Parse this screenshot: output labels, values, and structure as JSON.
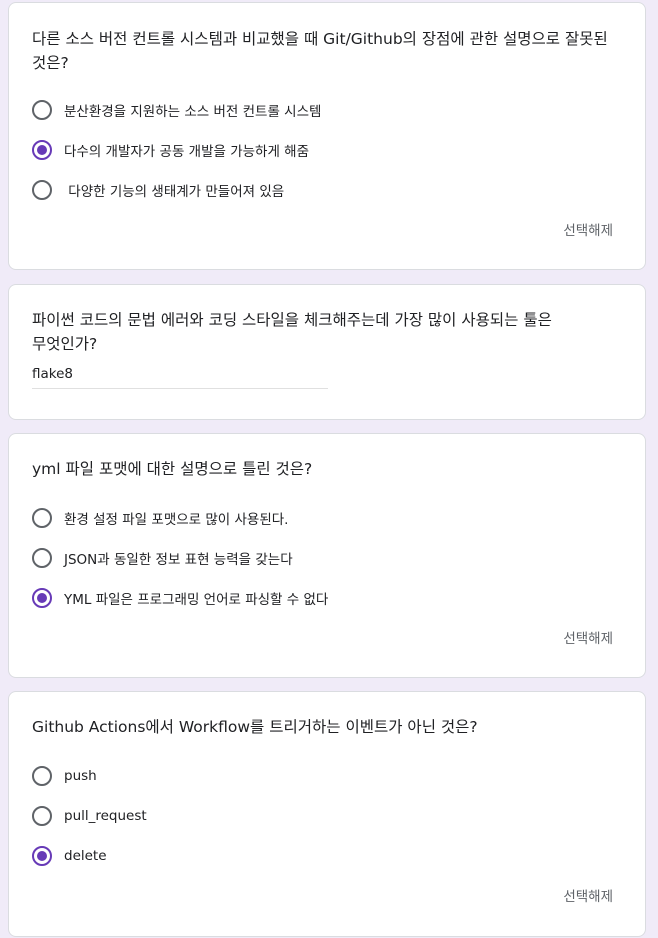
{
  "clear_label": "선택해제",
  "accent_color": "#673ab7",
  "questions": [
    {
      "title": "다른 소스 버전 컨트롤 시스템과 비교했을 때 Git/Github의 장점에 관한 설명으로 잘못된 것은?",
      "options": [
        {
          "label": "분산환경을 지원하는 소스 버전 컨트롤 시스템",
          "checked": false
        },
        {
          "label": "다수의 개발자가 공동 개발을 가능하게 해줌",
          "checked": true
        },
        {
          "label": " 다양한 기능의 생태계가 만들어져 있음",
          "checked": false
        }
      ]
    },
    {
      "title": "파이썬 코드의 문법 에러와 코딩 스타일을 체크해주는데 가장 많이 사용되는 툴은 무엇인가?",
      "answer": "flake8"
    },
    {
      "title": "yml 파일 포맷에 대한 설명으로 틀린 것은?",
      "options": [
        {
          "label": "환경 설정 파일 포맷으로 많이 사용된다.",
          "checked": false
        },
        {
          "label": "JSON과 동일한 정보 표현 능력을 갖는다",
          "checked": false
        },
        {
          "label": "YML 파일은 프로그래밍 언어로 파싱할 수 없다",
          "checked": true
        }
      ]
    },
    {
      "title": "Github Actions에서 Workflow를 트리거하는 이벤트가 아닌 것은?",
      "options": [
        {
          "label": "push",
          "checked": false
        },
        {
          "label": "pull_request",
          "checked": false
        },
        {
          "label": "delete",
          "checked": true
        }
      ]
    }
  ]
}
